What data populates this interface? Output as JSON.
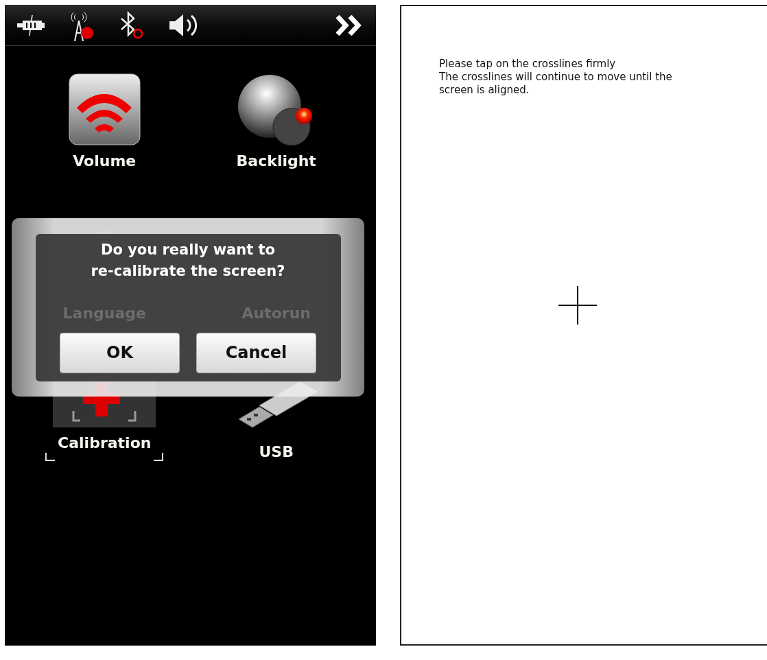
{
  "launcher": {
    "grid": [
      {
        "kind": "volume",
        "label": "Volume",
        "selected": false
      },
      {
        "kind": "backlight",
        "label": "Backlight",
        "selected": false
      },
      {
        "kind": "language",
        "label": "Language",
        "selected": false
      },
      {
        "kind": "autorun",
        "label": "Autorun",
        "selected": false
      },
      {
        "kind": "calibration",
        "label": "Calibration",
        "selected": true
      },
      {
        "kind": "usb",
        "label": "USB",
        "selected": false
      }
    ],
    "dialog": {
      "message": "Do you really want to re-calibrate the screen?",
      "buttons": [
        "OK",
        "Cancel"
      ]
    }
  },
  "calibration_screen": {
    "lines": [
      "Please tap on the crosslines firmly",
      "The crosslines will continue to move until the screen is aligned."
    ]
  }
}
